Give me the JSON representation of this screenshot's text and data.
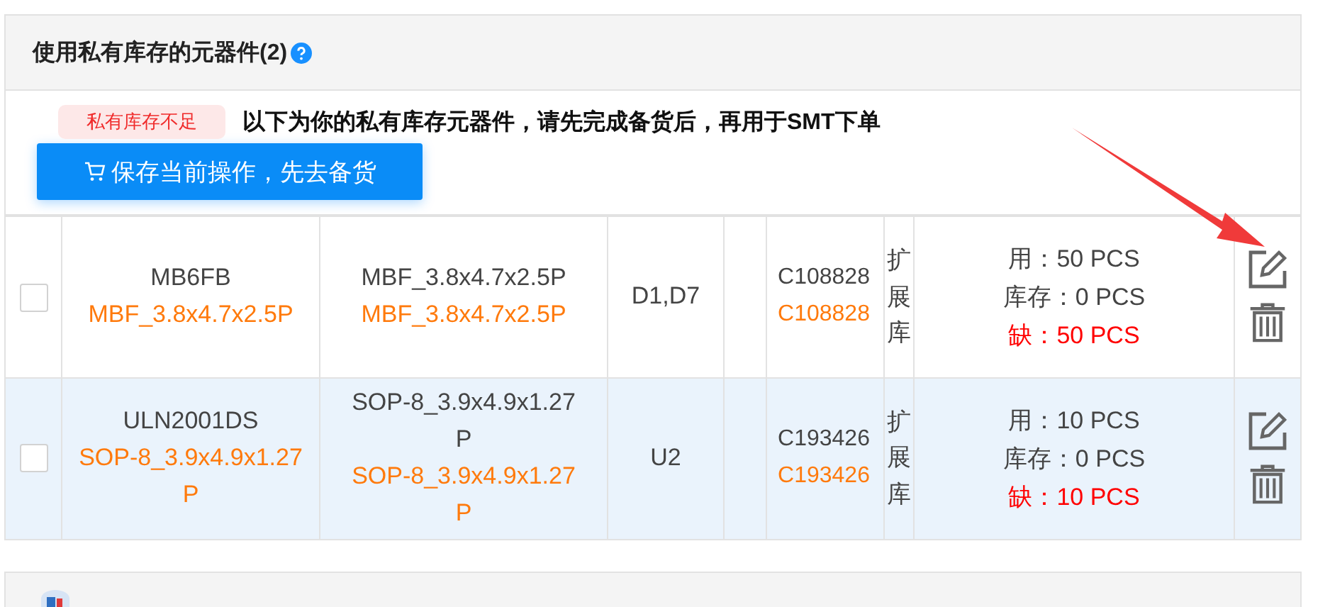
{
  "section": {
    "title": "使用私有库存的元器件(2)"
  },
  "notice": {
    "tag": "私有库存不足",
    "message": "以下为你的私有库存元器件，请先完成备货后，再用于SMT下单"
  },
  "stock_button": {
    "label": "保存当前操作，先去备货"
  },
  "rows": [
    {
      "checked": false,
      "hovered": false,
      "name": "MB6FB",
      "name_package": "MBF_3.8x4.7x2.5P",
      "package": "MBF_3.8x4.7x2.5P",
      "package_match": "MBF_3.8x4.7x2.5P",
      "designators": "D1,D7",
      "part_no": "C108828",
      "part_no_match": "C108828",
      "library": "扩展库",
      "used": "用：50 PCS",
      "stock": "库存：0 PCS",
      "shortage": "缺：50 PCS"
    },
    {
      "checked": false,
      "hovered": true,
      "name": "ULN2001DS",
      "name_package": "SOP-8_3.9x4.9x1.27P",
      "package": "SOP-8_3.9x4.9x1.27P",
      "package_match": "SOP-8_3.9x4.9x1.27P",
      "designators": "U2",
      "part_no": "C193426",
      "part_no_match": "C193426",
      "library": "扩展库",
      "used": "用：10 PCS",
      "stock": "库存：0 PCS",
      "shortage": "缺：10 PCS"
    }
  ]
}
